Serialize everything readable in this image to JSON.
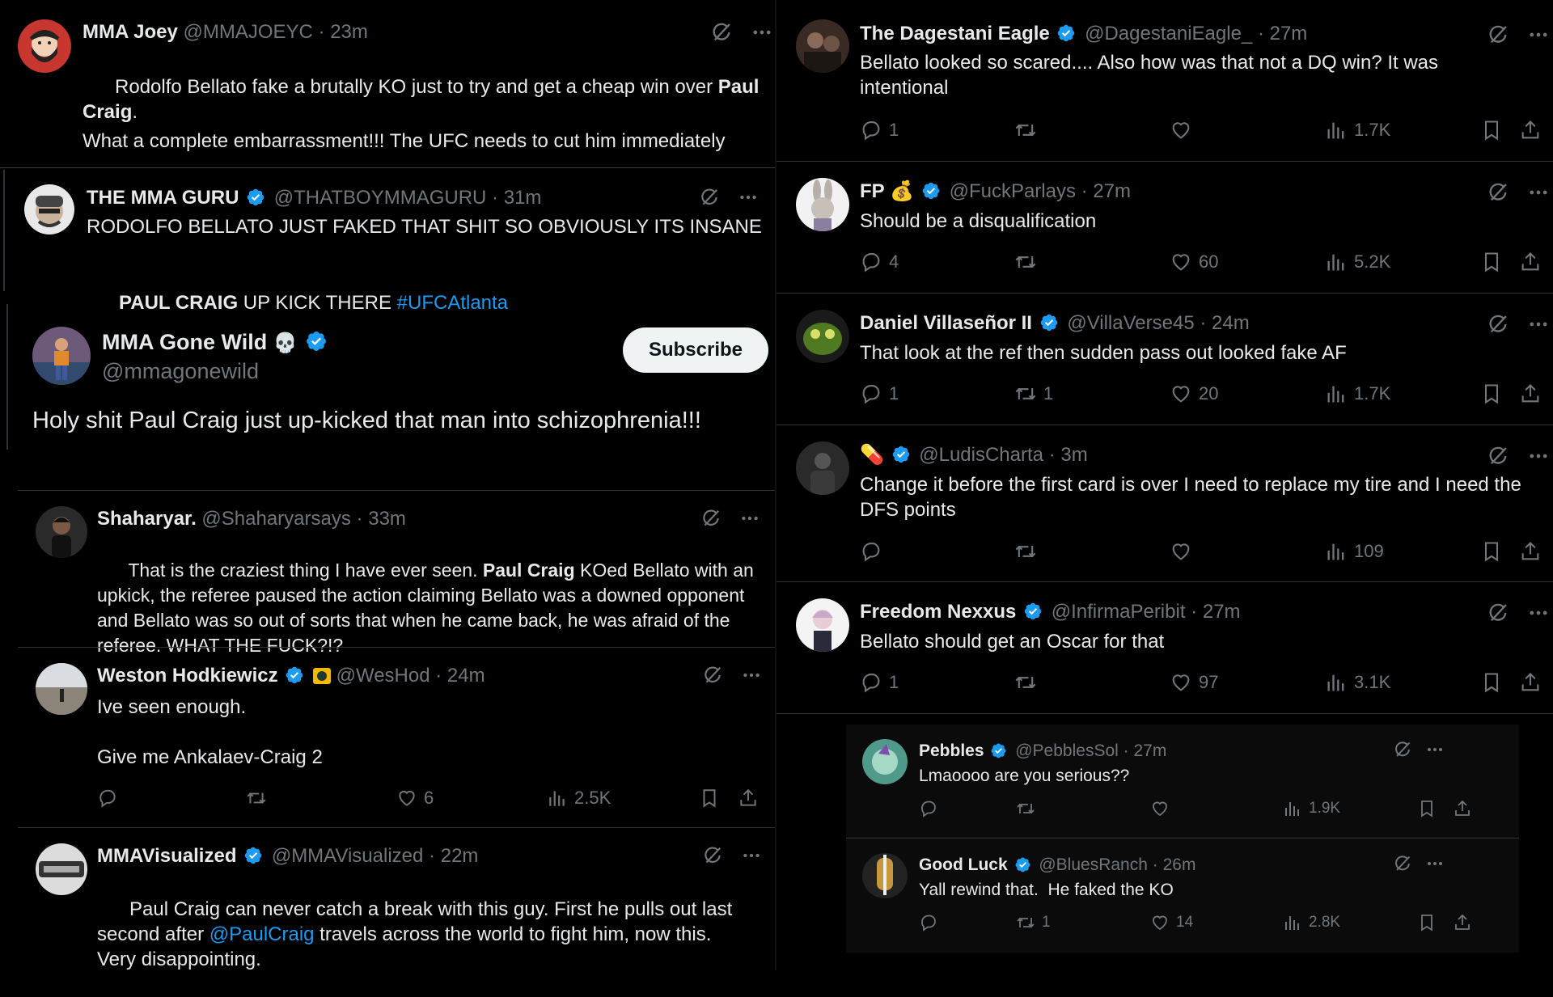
{
  "left": {
    "t1": {
      "name": "MMA Joey",
      "handle": "@MMAJOEYC",
      "time": "23m",
      "text_a": "Rodolfo Bellato fake a brutally KO just to try and get a cheap win over ",
      "text_b": "Paul Craig",
      "text_c": ".",
      "text_d": "What a complete embarrassment!!! The UFC needs to cut him immediately"
    },
    "t2": {
      "name": "THE MMA GURU",
      "handle": "@THATBOYMMAGURU",
      "time": "31m",
      "text_a": "RODOLFO BELLATO JUST FAKED THAT SHIT SO OBVIOUSLY ITS INSANE",
      "text_b": "PAUL CRAIG",
      "text_c": " UP KICK THERE ",
      "text_link": "#UFCAtlanta"
    },
    "t3": {
      "name": "MMA Gone Wild",
      "handle": "@mmagonewild",
      "subscribe": "Subscribe",
      "text": "Holy shit Paul Craig just up-kicked that man into schizophrenia!!!"
    },
    "t4": {
      "name": "Shaharyar.",
      "handle": "@Shaharyarsays",
      "time": "33m",
      "text_a": "That is the craziest thing I have ever seen. ",
      "text_b": "Paul Craig",
      "text_c": " KOed Bellato with an upkick, the referee paused the action claiming Bellato was a downed opponent and Bellato was so out of sorts that when he came back, he was afraid of the referee. WHAT THE FUCK?!?"
    },
    "t5": {
      "name": "Weston Hodkiewicz",
      "handle": "@WesHod",
      "time": "24m",
      "text_a": "Ive seen enough.",
      "text_b": "Give me Ankalaev-Craig 2",
      "replies": "",
      "retweets": "",
      "likes": "6",
      "views": "2.5K"
    },
    "t6": {
      "name": "MMAVisualized",
      "handle": "@MMAVisualized",
      "time": "22m",
      "text_a": "Paul Craig can never catch a break with this guy. First he pulls out last second after ",
      "text_link": "@PaulCraig",
      "text_c": " travels across the world to fight him, now this. Very disappointing."
    }
  },
  "right": {
    "r1": {
      "name": "The Dagestani Eagle",
      "handle": "@DagestaniEagle_",
      "time": "27m",
      "text": "Bellato looked so scared.... Also how was that not a DQ win? It was intentional",
      "replies": "1",
      "retweets": "",
      "likes": "",
      "views": "1.7K"
    },
    "r2": {
      "name": "FP",
      "emoji": "💰",
      "handle": "@FuckParlays",
      "time": "27m",
      "text": "Should be a disqualification",
      "replies": "4",
      "retweets": "",
      "likes": "60",
      "views": "5.2K"
    },
    "r3": {
      "name": "Daniel Villaseñor II",
      "handle": "@VillaVerse45",
      "time": "24m",
      "text": "That look at the ref then sudden pass out looked fake AF",
      "replies": "1",
      "retweets": "1",
      "likes": "20",
      "views": "1.7K"
    },
    "r4": {
      "name": "",
      "emoji": "💊",
      "handle": "@LudisCharta",
      "time": "3m",
      "text": "Change it before the first card is over I need to replace my tire and I need the DFS points",
      "replies": "",
      "retweets": "",
      "likes": "",
      "views": "109"
    },
    "r5": {
      "name": "Freedom Nexxus",
      "handle": "@InfirmaPeribit",
      "time": "27m",
      "text": "Bellato should get an Oscar for that",
      "replies": "1",
      "retweets": "",
      "likes": "97",
      "views": "3.1K"
    },
    "r6": {
      "name": "Pebbles",
      "handle": "@PebblesSol",
      "time": "27m",
      "text": "Lmaoooo are you serious??",
      "replies": "",
      "retweets": "",
      "likes": "",
      "views": "1.9K"
    },
    "r7": {
      "name": "Good Luck",
      "handle": "@BluesRanch",
      "time": "26m",
      "text": "Yall rewind that.  He faked the KO",
      "replies": "",
      "retweets": "1",
      "likes": "14",
      "views": "2.8K"
    }
  },
  "colors": {
    "bg": "#000000",
    "text": "#e7e9ea",
    "muted": "#71767b",
    "link": "#1d9bf0",
    "verified": "#1d9bf0",
    "border": "#2f3336"
  },
  "icons": [
    "verified-badge-icon",
    "grok-icon",
    "more-icon",
    "reply-icon",
    "retweet-icon",
    "like-icon",
    "views-icon",
    "bookmark-icon",
    "share-icon"
  ]
}
